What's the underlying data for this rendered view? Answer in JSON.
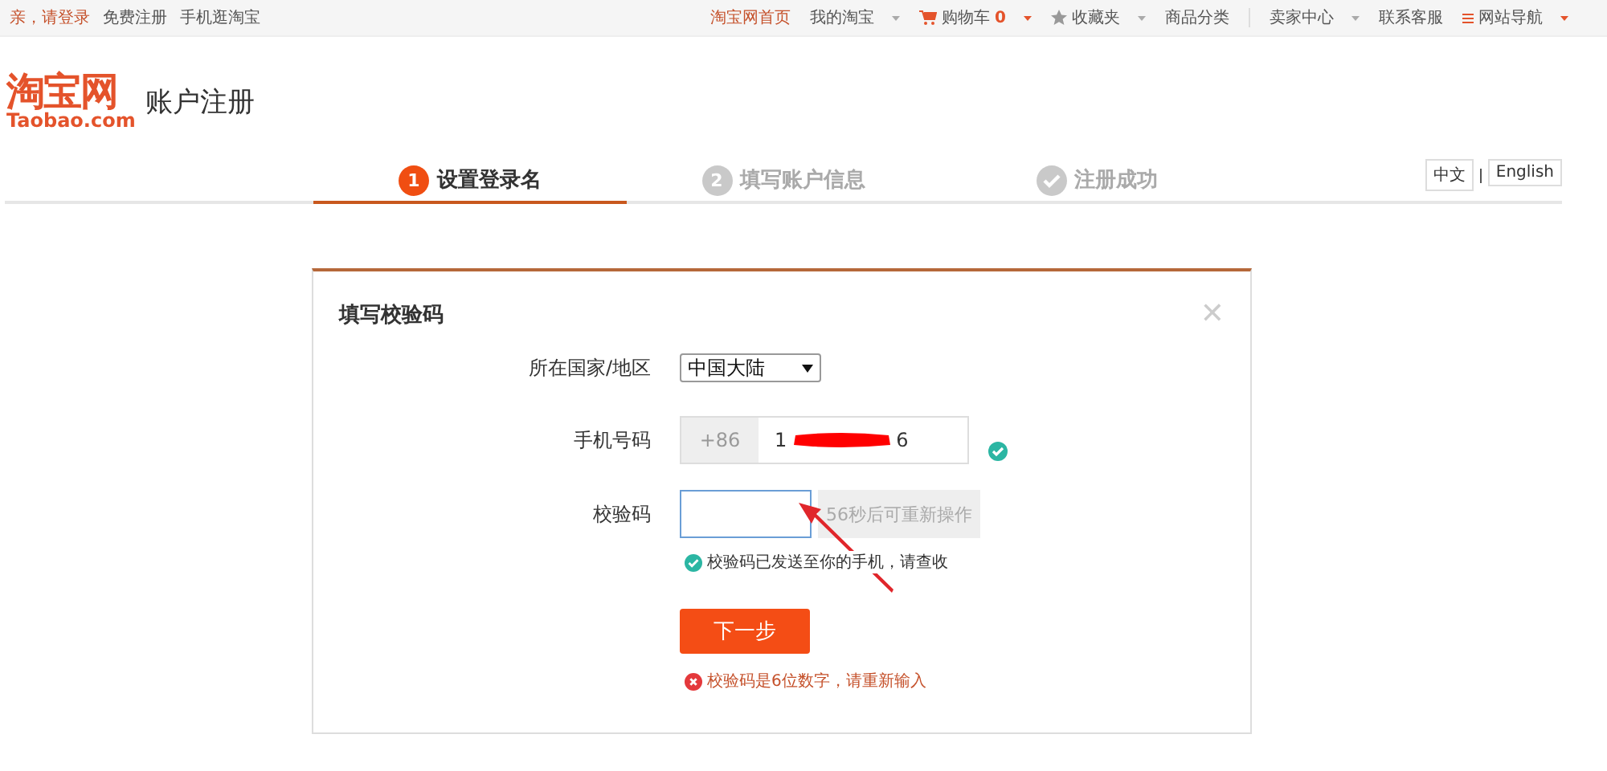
{
  "top_bar": {
    "left": [
      {
        "label": "亲，请登录",
        "kind": "accent"
      },
      {
        "label": "免费注册",
        "kind": "plain"
      },
      {
        "label": "手机逛淘宝",
        "kind": "plain"
      }
    ],
    "right": [
      {
        "label": "淘宝网首页",
        "kind": "home",
        "caret": false
      },
      {
        "label": "我的淘宝",
        "kind": "plain",
        "caret": true
      },
      {
        "label": "购物车",
        "kind": "cart",
        "caret": true,
        "count": "0"
      },
      {
        "label": "收藏夹",
        "kind": "star",
        "caret": true
      },
      {
        "label": "商品分类",
        "kind": "plain",
        "caret": false,
        "divider_after": true
      },
      {
        "label": "卖家中心",
        "kind": "plain",
        "caret": true
      },
      {
        "label": "联系客服",
        "kind": "plain",
        "caret": false
      },
      {
        "label": "网站导航",
        "kind": "menu",
        "caret": true
      }
    ]
  },
  "header": {
    "logo_cn": "淘宝网",
    "logo_en": "Taobao.com",
    "title": "账户注册"
  },
  "steps": [
    {
      "number": "1",
      "label": "设置登录名",
      "selected": true,
      "done": false
    },
    {
      "number": "2",
      "label": "填写账户信息",
      "selected": false,
      "done": false
    },
    {
      "label": "注册成功",
      "selected": false,
      "done": true
    }
  ],
  "languages": [
    "中文",
    "English"
  ],
  "dialog": {
    "title": "填写校验码",
    "close": "✕",
    "country": {
      "label": "所在国家/地区",
      "value": "中国大陆"
    },
    "phone": {
      "label": "手机号码",
      "prefix": "+86",
      "value_start": "1",
      "value_end": "6",
      "valid": true
    },
    "code": {
      "label": "校验码",
      "resend": "56秒后可重新操作",
      "focused": true
    },
    "notice": "校验码已发送至你的手机，请查收",
    "submit": "下一步",
    "error": "校验码是6位数字，请重新输入"
  }
}
